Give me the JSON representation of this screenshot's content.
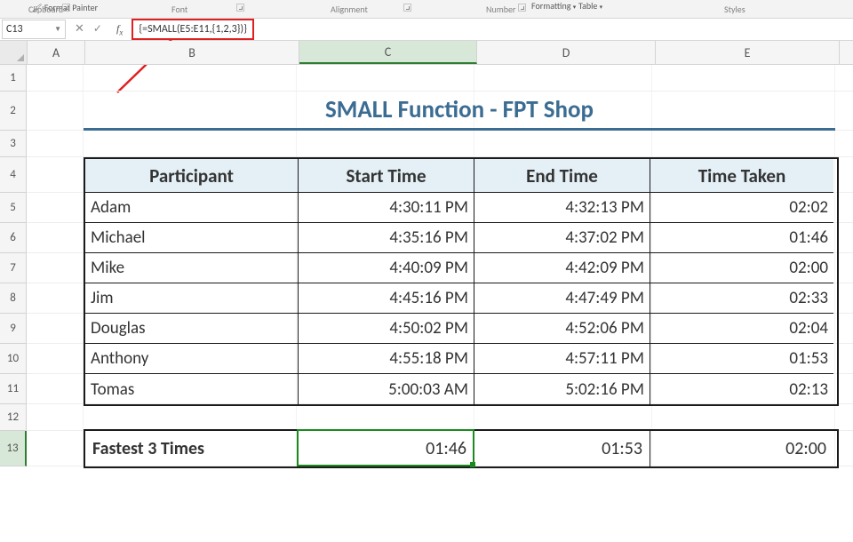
{
  "ribbon": {
    "format_painter": "Format Painter",
    "groups": {
      "clipboard": "Clipboard",
      "font": "Font",
      "alignment": "Alignment",
      "number": "Number",
      "styles": "Styles"
    },
    "formatting": "Formatting",
    "table": "Table"
  },
  "namebox": "C13",
  "formula": "{=SMALL(E5:E11,{1,2,3})}",
  "columns": [
    "A",
    "B",
    "C",
    "D",
    "E"
  ],
  "row_nums": [
    "1",
    "2",
    "3",
    "4",
    "5",
    "6",
    "7",
    "8",
    "9",
    "10",
    "11",
    "12",
    "13"
  ],
  "title": "SMALL Function - FPT Shop",
  "headers": {
    "participant": "Participant",
    "start": "Start Time",
    "end": "End Time",
    "taken": "Time Taken"
  },
  "rows": [
    {
      "p": "Adam",
      "s": "4:30:11 PM",
      "e": "4:32:13 PM",
      "t": "02:02"
    },
    {
      "p": "Michael",
      "s": "4:35:16 PM",
      "e": "4:37:02 PM",
      "t": "01:46"
    },
    {
      "p": "Mike",
      "s": "4:40:09 PM",
      "e": "4:42:09 PM",
      "t": "02:00"
    },
    {
      "p": "Jim",
      "s": "4:45:16 PM",
      "e": "4:47:49 PM",
      "t": "02:33"
    },
    {
      "p": "Douglas",
      "s": "4:50:02 PM",
      "e": "4:52:06 PM",
      "t": "02:04"
    },
    {
      "p": "Anthony",
      "s": "4:55:18 PM",
      "e": "4:57:11 PM",
      "t": "01:53"
    },
    {
      "p": "Tomas",
      "s": "5:00:03 AM",
      "e": "5:02:16 PM",
      "t": "02:13"
    }
  ],
  "fastest": {
    "label": "Fastest 3 Times",
    "v": [
      "01:46",
      "01:53",
      "02:00"
    ]
  }
}
